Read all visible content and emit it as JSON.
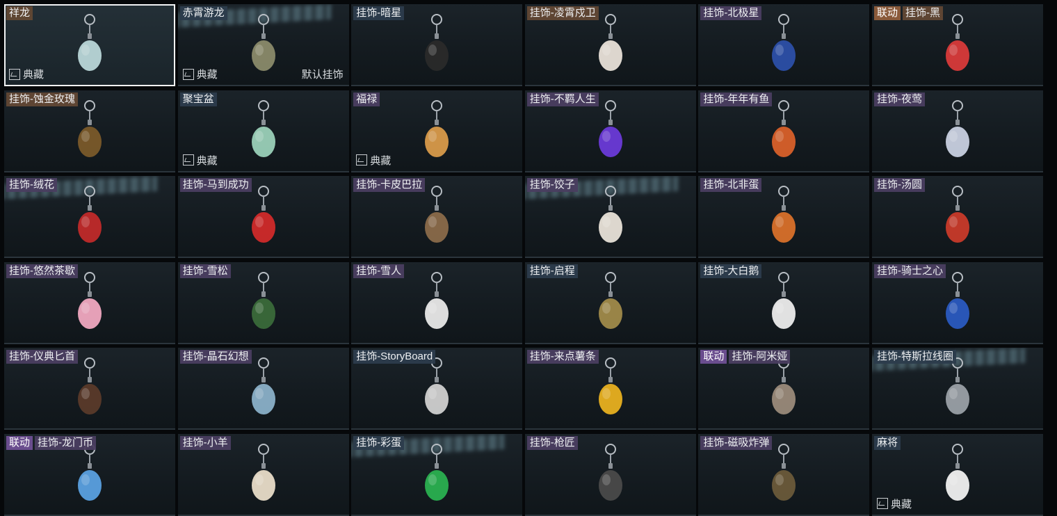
{
  "items": [
    {
      "name": "祥龙",
      "collection": "典藏",
      "rarity": "gold",
      "selected": true,
      "icon": "dragon-charm-icon",
      "color": "#b9d6d8"
    },
    {
      "name": "赤霄游龙",
      "collection": "典藏",
      "default": "默认挂饰",
      "rarity": "blue",
      "glare": true,
      "icon": "dragon-figure-charm-icon",
      "color": "#8a8a6a"
    },
    {
      "name": "挂饰-暗星",
      "rarity": "blue",
      "icon": "dark-star-charm-icon",
      "color": "#2a2a2a"
    },
    {
      "name": "挂饰-凌霄戍卫",
      "rarity": "gold",
      "icon": "rocket-charm-icon",
      "color": "#e8e0d8"
    },
    {
      "name": "挂饰-北极星",
      "rarity": "purple",
      "icon": "north-star-charm-icon",
      "color": "#2c4fa8"
    },
    {
      "name": "挂饰-黑",
      "collab": "联动",
      "rarity": "gold",
      "icon": "black-charm-icon",
      "color": "#d83a3a"
    },
    {
      "name": "挂饰-蚀金玫瑰",
      "rarity": "gold",
      "icon": "gold-rose-charm-icon",
      "color": "#7a5a2a"
    },
    {
      "name": "聚宝盆",
      "collection": "典藏",
      "rarity": "blue",
      "icon": "treasure-bowl-charm-icon",
      "color": "#9ad0b8"
    },
    {
      "name": "福禄",
      "collection": "典藏",
      "rarity": "purple",
      "icon": "gourd-charm-icon",
      "color": "#d89a4a"
    },
    {
      "name": "挂饰-不羁人生",
      "rarity": "purple",
      "icon": "sneaker-charm-icon",
      "color": "#6a3ad8"
    },
    {
      "name": "挂饰-年年有鱼",
      "rarity": "purple",
      "icon": "fish-charm-icon",
      "color": "#d8602a"
    },
    {
      "name": "挂饰-夜莺",
      "rarity": "purple",
      "icon": "feather-charm-icon",
      "color": "#c8d0e0"
    },
    {
      "name": "挂饰-绒花",
      "rarity": "purple",
      "glare": true,
      "icon": "velvet-flower-charm-icon",
      "color": "#c02a2a"
    },
    {
      "name": "挂饰-马到成功",
      "rarity": "purple",
      "icon": "horse-charm-icon",
      "color": "#d02a2a"
    },
    {
      "name": "挂饰-卡皮巴拉",
      "rarity": "purple",
      "icon": "capybara-charm-icon",
      "color": "#8a6a4a"
    },
    {
      "name": "挂饰-饺子",
      "rarity": "purple",
      "glare": true,
      "icon": "dumpling-charm-icon",
      "color": "#e8e2d8"
    },
    {
      "name": "挂饰-北非蛋",
      "rarity": "purple",
      "icon": "shakshuka-charm-icon",
      "color": "#d8702a"
    },
    {
      "name": "挂饰-汤圆",
      "rarity": "purple",
      "icon": "rice-ball-charm-icon",
      "color": "#c83a2a"
    },
    {
      "name": "挂饰-悠然茶歇",
      "rarity": "purple",
      "icon": "cupcake-charm-icon",
      "color": "#f0a8c0"
    },
    {
      "name": "挂饰-雪松",
      "rarity": "purple",
      "icon": "pine-tree-charm-icon",
      "color": "#3a6a3a"
    },
    {
      "name": "挂饰-雪人",
      "rarity": "purple",
      "icon": "snowman-charm-icon",
      "color": "#e8e8e8"
    },
    {
      "name": "挂饰-启程",
      "rarity": "blue",
      "icon": "badge-charm-icon",
      "color": "#a08a4a"
    },
    {
      "name": "挂饰-大白鹅",
      "rarity": "blue",
      "icon": "goose-charm-icon",
      "color": "#ececec"
    },
    {
      "name": "挂饰-骑士之心",
      "rarity": "purple",
      "icon": "knight-shield-charm-icon",
      "color": "#2a5ac0"
    },
    {
      "name": "挂饰-仪典匕首",
      "rarity": "purple",
      "icon": "dagger-charm-icon",
      "color": "#5a3a2a"
    },
    {
      "name": "挂饰-晶石幻想",
      "rarity": "purple",
      "icon": "crystal-cube-charm-icon",
      "color": "#8ab0c8"
    },
    {
      "name": "挂饰-StoryBoard",
      "rarity": "blue",
      "icon": "id-card-charm-icon",
      "color": "#d0d0d0"
    },
    {
      "name": "挂饰-来点薯条",
      "rarity": "purple",
      "icon": "fries-charm-icon",
      "color": "#e8b020"
    },
    {
      "name": "挂饰-阿米娅",
      "collab": "联动",
      "rarity": "purple",
      "icon": "amiya-charm-icon",
      "color": "#9a8a7a"
    },
    {
      "name": "挂饰-特斯拉线圈",
      "rarity": "blue",
      "glare": true,
      "icon": "tesla-coil-charm-icon",
      "color": "#9aa0a6"
    },
    {
      "name": "挂饰-龙门币",
      "collab": "联动",
      "rarity": "purple",
      "icon": "lungmen-coin-charm-icon",
      "color": "#5aa0e0"
    },
    {
      "name": "挂饰-小羊",
      "rarity": "purple",
      "icon": "lamb-charm-icon",
      "color": "#e8dcc8"
    },
    {
      "name": "挂饰-彩蛋",
      "rarity": "blue",
      "glare": true,
      "icon": "easter-egg-charm-icon",
      "color": "#2ab050"
    },
    {
      "name": "挂饰-枪匠",
      "rarity": "purple",
      "icon": "gunsmith-crate-charm-icon",
      "color": "#4a4a4a"
    },
    {
      "name": "挂饰-磁吸炸弹",
      "rarity": "purple",
      "icon": "magnet-bomb-charm-icon",
      "color": "#6a5a3a"
    },
    {
      "name": "麻将",
      "collection": "典藏",
      "rarity": "blue",
      "icon": "mahjong-charm-icon",
      "color": "#f0f0f0"
    }
  ]
}
